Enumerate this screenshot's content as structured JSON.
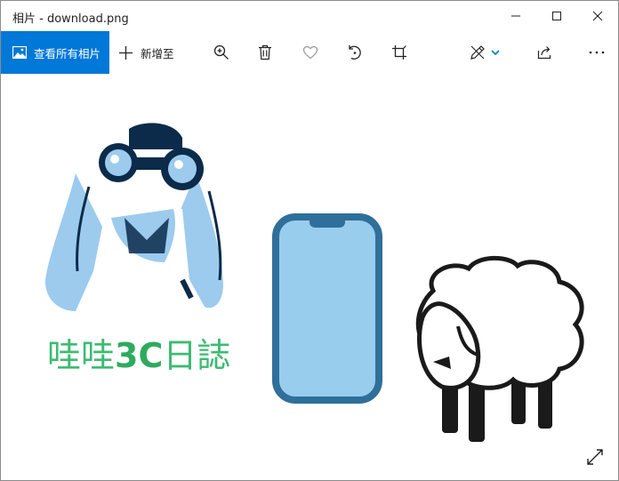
{
  "window": {
    "title": "相片 - download.png"
  },
  "toolbar": {
    "view_all_label": "查看所有相片",
    "add_to_label": "新增至"
  },
  "image": {
    "logo_part1": "哇哇",
    "logo_part2": "3C",
    "logo_part3": "日誌"
  },
  "colors": {
    "accent": "#0078d7",
    "logo_green": "#3dbb73",
    "phone_blue": "#99cdee",
    "phone_border": "#2f6f9a",
    "figure_dark": "#0c2b4a",
    "figure_light": "#9ccbee"
  },
  "icons": [
    "image-icon",
    "plus-icon",
    "zoom-icon",
    "delete-icon",
    "favorite-icon",
    "rotate-icon",
    "crop-icon",
    "edit-icon",
    "chevron-down-icon",
    "share-icon",
    "more-icon",
    "minimize-icon",
    "maximize-icon",
    "close-icon",
    "fullscreen-icon"
  ]
}
